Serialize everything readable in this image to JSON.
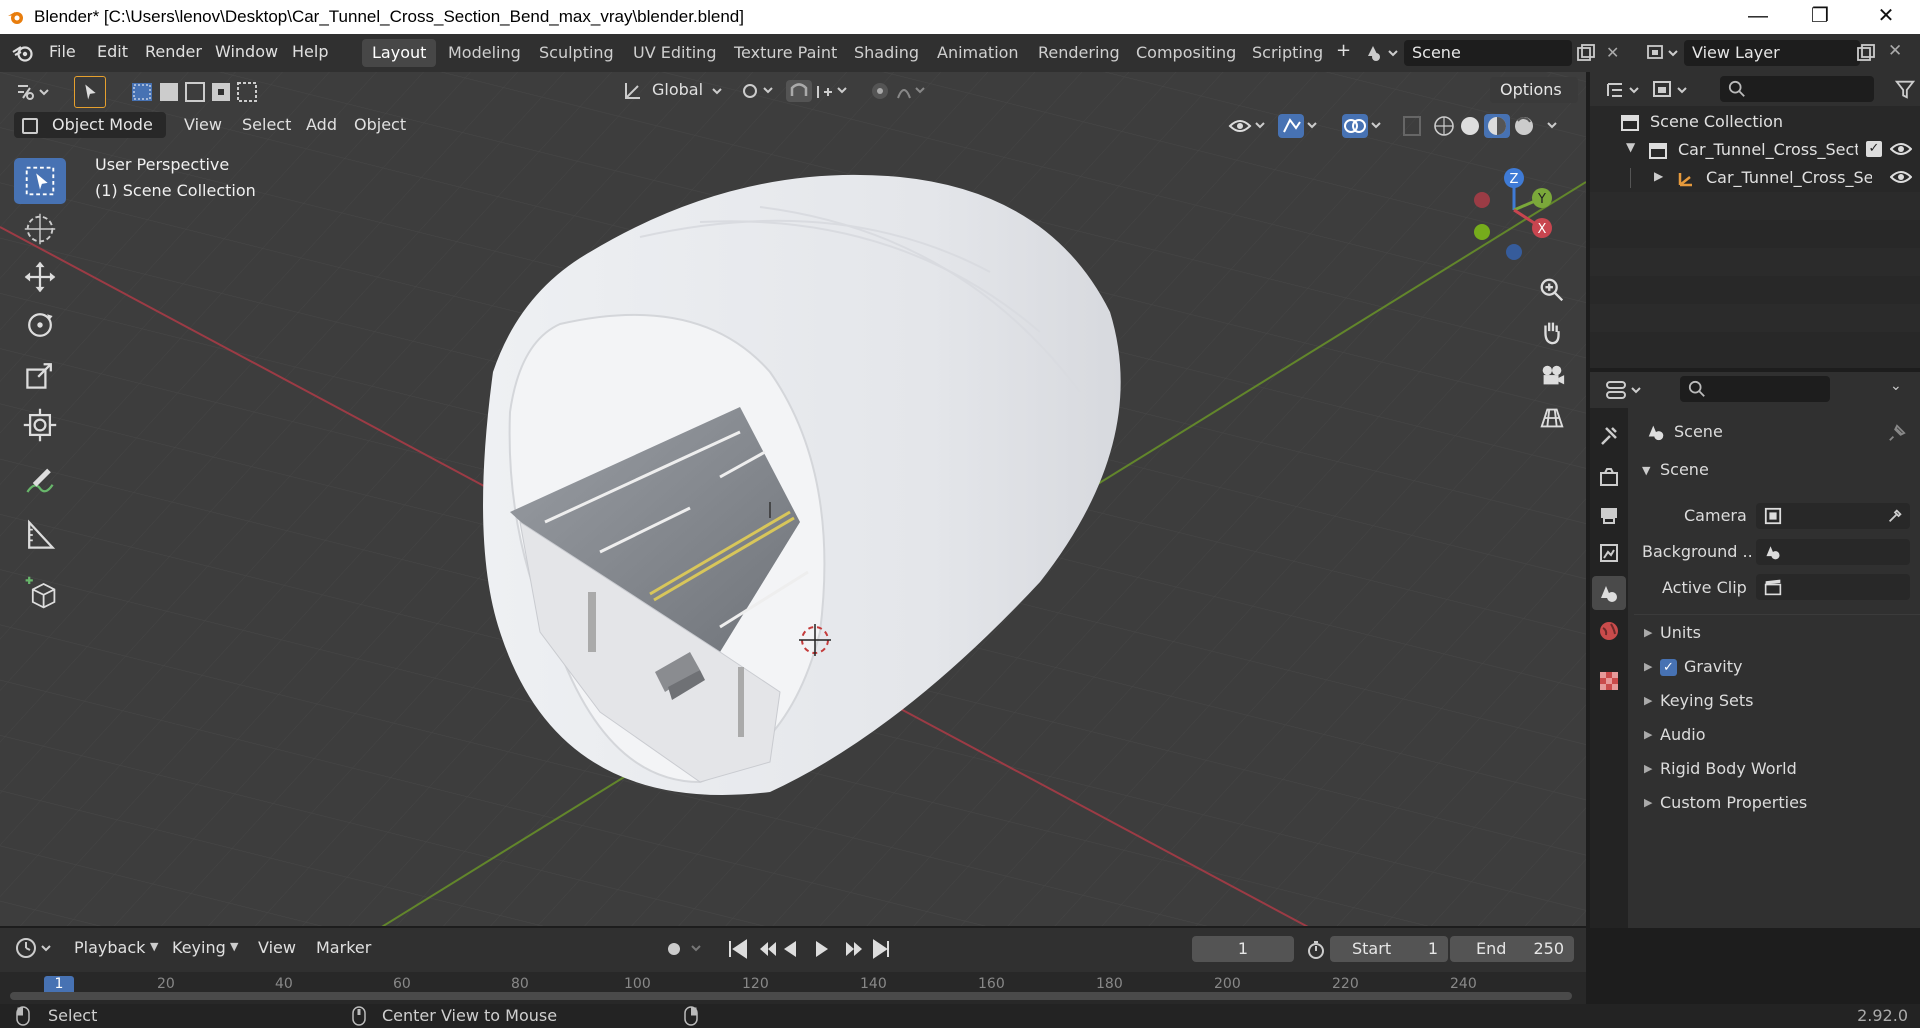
{
  "titlebar": {
    "title": "Blender* [C:\\Users\\lenov\\Desktop\\Car_Tunnel_Cross_Section_Bend_max_vray\\blender.blend]",
    "minimize": "—",
    "restore": "❐",
    "close": "✕"
  },
  "menu": [
    "File",
    "Edit",
    "Render",
    "Window",
    "Help"
  ],
  "workspaces": [
    "Layout",
    "Modeling",
    "Sculpting",
    "UV Editing",
    "Texture Paint",
    "Shading",
    "Animation",
    "Rendering",
    "Compositing",
    "Scripting"
  ],
  "workspace_add": "+",
  "scene_field": "Scene",
  "view_layer_field": "View Layer",
  "header": {
    "transform_orientation": "Global",
    "options": "Options",
    "mode": "Object Mode",
    "view": "View",
    "select": "Select",
    "add": "Add",
    "object": "Object"
  },
  "viewport": {
    "perspective": "User Perspective",
    "collection": "(1) Scene Collection"
  },
  "gizmo": {
    "x": "X",
    "y": "Y",
    "z": "Z"
  },
  "outliner": {
    "root": "Scene Collection",
    "items": [
      {
        "label": "Car_Tunnel_Cross_Sectio"
      },
      {
        "label": "Car_Tunnel_Cross_Se"
      }
    ]
  },
  "properties": {
    "context": "Scene",
    "panel": "Scene",
    "camera_label": "Camera",
    "background_label": "Background ...",
    "active_clip_label": "Active Clip",
    "sections": [
      "Units",
      "Gravity",
      "Keying Sets",
      "Audio",
      "Rigid Body World",
      "Custom Properties"
    ]
  },
  "timeline": {
    "playback": "Playback",
    "keying": "Keying",
    "view": "View",
    "marker": "Marker",
    "current_frame": "1",
    "start_label": "Start",
    "start": "1",
    "end_label": "End",
    "end": "250",
    "ruler": [
      "1",
      "20",
      "40",
      "60",
      "80",
      "100",
      "120",
      "140",
      "160",
      "180",
      "200",
      "220",
      "240"
    ]
  },
  "status": {
    "select": "Select",
    "center": "Center View to Mouse",
    "version": "2.92.0"
  },
  "colors": {
    "accent": "#4772b3",
    "x_axis": "#c8454f",
    "y_axis": "#7ba83a",
    "z_axis": "#3f7bd6"
  }
}
